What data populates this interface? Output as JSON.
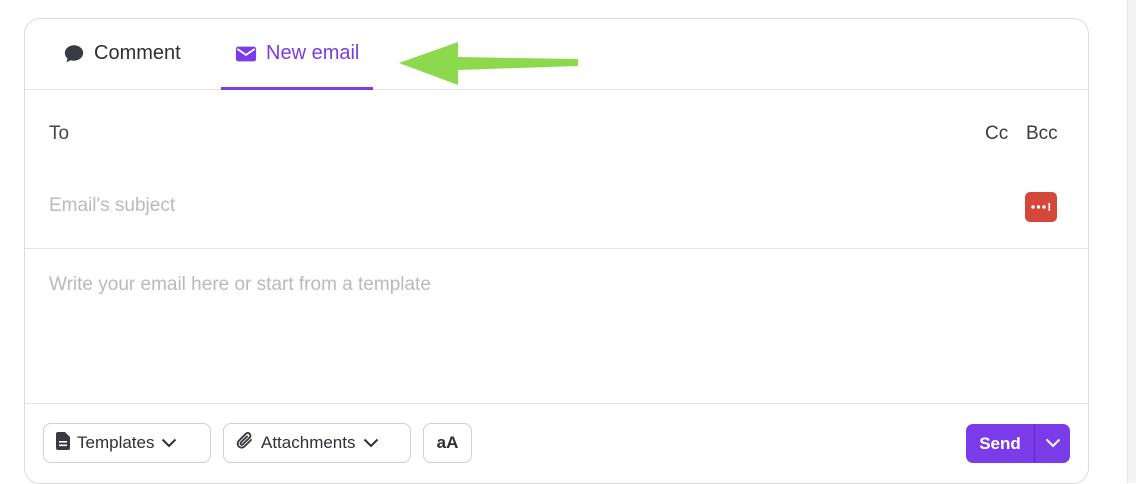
{
  "tabs": {
    "comment_label": "Comment",
    "new_email_label": "New email"
  },
  "compose": {
    "to_label": "To",
    "cc_label": "Cc",
    "bcc_label": "Bcc",
    "subject_placeholder": "Email's subject",
    "body_placeholder": "Write your email here or start from a template"
  },
  "toolbar": {
    "templates_label": "Templates",
    "attachments_label": "Attachments",
    "format_label": "aA",
    "send_label": "Send"
  },
  "icons": {
    "comment": "comment-bubble-icon",
    "email": "envelope-icon",
    "templates": "document-icon",
    "attachments": "paperclip-icon",
    "dropdown": "chevron-down-icon",
    "password_manager": "password-manager-icon",
    "annotation": "arrow-left-icon"
  },
  "colors": {
    "accent": "#7a3ce8",
    "arrow": "#8cd94e",
    "password_manager": "#d4483b"
  }
}
